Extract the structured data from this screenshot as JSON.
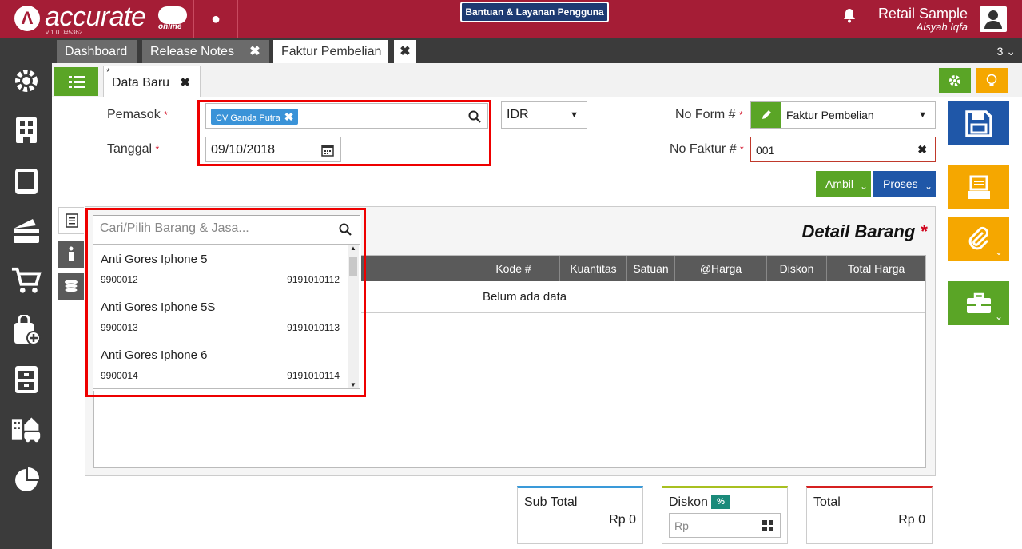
{
  "header": {
    "logo_mark": "Λ",
    "logo_text": "accurate",
    "logo_sub": "online",
    "version": "v 1.0.0#5362",
    "dot": "●",
    "help_button": "Bantuan & Layanan Pengguna",
    "company": "Retail Sample",
    "user": "Aisyah Iqfa"
  },
  "tabs": [
    {
      "label": "Dashboard"
    },
    {
      "label": "Release Notes"
    },
    {
      "label": "Faktur Pembelian"
    }
  ],
  "tab_close": "✖",
  "tab_count": "3",
  "subtab": {
    "star": "*",
    "label": "Data Baru",
    "close": "✖"
  },
  "form": {
    "pemasok_label": "Pemasok",
    "pemasok_chip": "CV Ganda Putra",
    "tanggal_label": "Tanggal",
    "tanggal_value": "09/10/2018",
    "currency": "IDR",
    "no_form_label": "No Form #",
    "no_form_value": "Faktur Pembelian",
    "no_faktur_label": "No Faktur #",
    "no_faktur_value": "001",
    "req": "*"
  },
  "buttons": {
    "ambil": "Ambil",
    "proses": "Proses"
  },
  "detail": {
    "title": "Detail Barang",
    "star": "*",
    "columns": [
      "Kode #",
      "Kuantitas",
      "Satuan",
      "@Harga",
      "Diskon",
      "Total Harga"
    ],
    "empty": "Belum ada data"
  },
  "dropdown": {
    "placeholder": "Cari/Pilih Barang & Jasa...",
    "items": [
      {
        "name": "Anti Gores Iphone 5",
        "code": "9900012",
        "barcode": "9191010112"
      },
      {
        "name": "Anti Gores Iphone 5S",
        "code": "9900013",
        "barcode": "9191010113"
      },
      {
        "name": "Anti Gores Iphone 6",
        "code": "9900014",
        "barcode": "9191010114"
      }
    ]
  },
  "totals": {
    "subtotal_label": "Sub Total",
    "subtotal_value": "Rp 0",
    "diskon_label": "Diskon",
    "diskon_badge": "%",
    "diskon_placeholder": "Rp",
    "total_label": "Total",
    "total_value": "Rp 0"
  },
  "colors": {
    "brand": "#a51d36",
    "green": "#5aa526",
    "blue": "#1f57a8",
    "orange": "#f5a700",
    "highlight": "#e00000"
  }
}
